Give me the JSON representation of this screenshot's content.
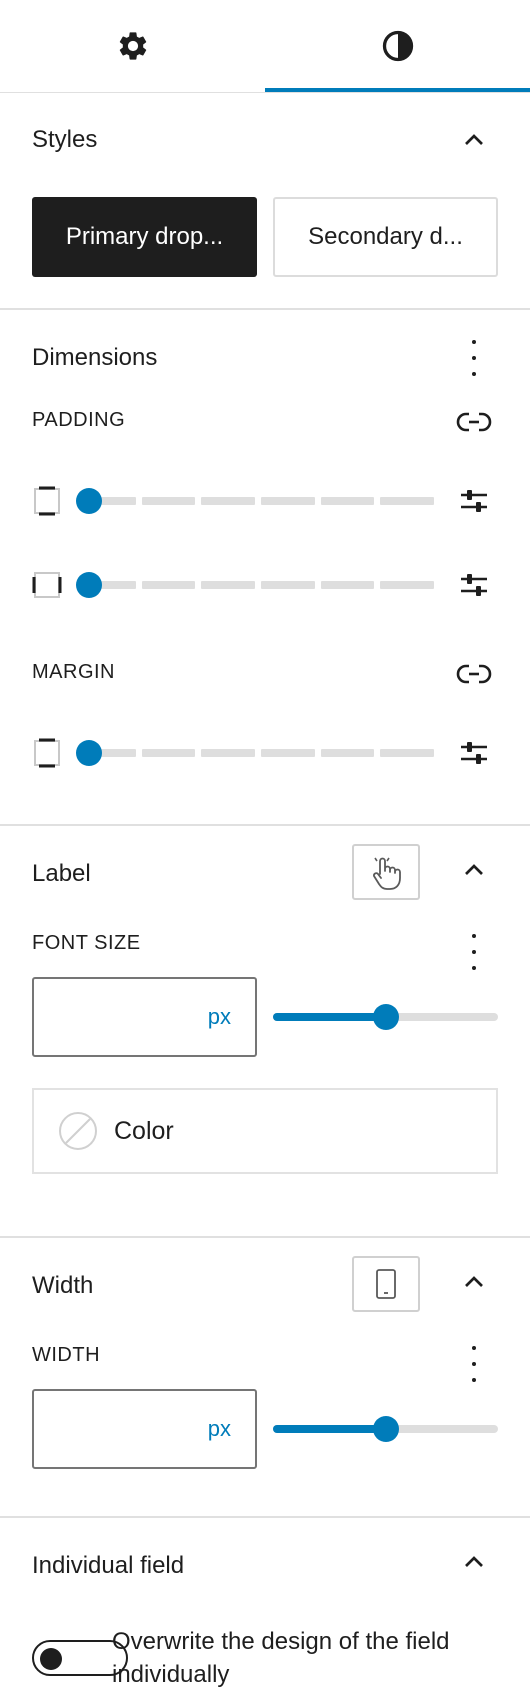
{
  "tabs": [
    {
      "id": "settings",
      "icon": "gear-icon",
      "active": false
    },
    {
      "id": "styles",
      "icon": "contrast-icon",
      "active": true
    }
  ],
  "colors": {
    "accent": "#007cba",
    "dark": "#1e1e1e",
    "border": "#e0e0e0"
  },
  "styles_section": {
    "title": "Styles",
    "buttons": [
      {
        "label": "Primary drop...",
        "selected": true
      },
      {
        "label": "Secondary d...",
        "selected": false
      }
    ]
  },
  "dimensions": {
    "title": "Dimensions",
    "padding": {
      "label": "PADDING",
      "rows": [
        {
          "side": "vertical",
          "value_fraction": 0
        },
        {
          "side": "horizontal",
          "value_fraction": 0
        }
      ]
    },
    "margin": {
      "label": "MARGIN",
      "rows": [
        {
          "side": "vertical",
          "value_fraction": 0
        }
      ]
    }
  },
  "label_section": {
    "title": "Label",
    "font_size": {
      "label": "FONT SIZE",
      "value": "",
      "unit": "px",
      "slider_fraction": 0.5
    },
    "color": {
      "label": "Color"
    }
  },
  "width_section": {
    "title": "Width",
    "width": {
      "label": "WIDTH",
      "value": "",
      "unit": "px",
      "slider_fraction": 0.5
    }
  },
  "individual_field": {
    "title": "Individual field",
    "toggle": {
      "label": "Overwrite the design of the field individually",
      "checked": false
    }
  }
}
